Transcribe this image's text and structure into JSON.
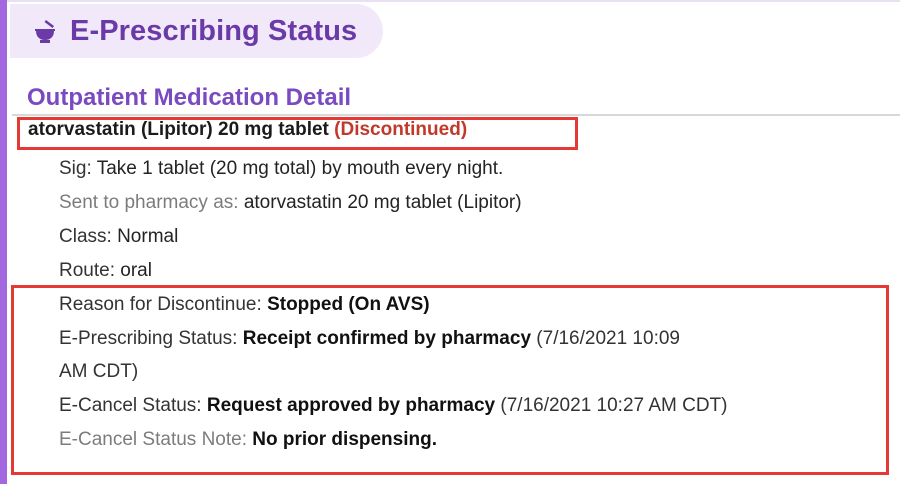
{
  "header": {
    "title": "E-Prescribing Status",
    "icon": "mortar-pestle-icon",
    "accent_color": "#6a3aa6",
    "pill_background": "#f1e8fa"
  },
  "section": {
    "heading": "Outpatient Medication Detail"
  },
  "medication": {
    "name": "atorvastatin (Lipitor) 20 mg tablet",
    "status": "(Discontinued)",
    "status_color": "#c0392b"
  },
  "details": {
    "sig_label": "Sig:",
    "sig_value": "Take 1 tablet (20 mg total) by mouth every night.",
    "sent_label": "Sent to pharmacy as:",
    "sent_value": "atorvastatin 20 mg tablet (Lipitor)",
    "class_label": "Class:",
    "class_value": "Normal",
    "route_label": "Route:",
    "route_value": "oral"
  },
  "status_details": {
    "reason_label": "Reason for Discontinue:",
    "reason_value": "Stopped (On AVS)",
    "erx_label": "E-Prescribing Status:",
    "erx_value": "Receipt confirmed by pharmacy",
    "erx_time_part1": "(7/16/2021 10:09",
    "erx_time_part2": "AM CDT)",
    "cancel_label": "E-Cancel Status:",
    "cancel_value": "Request approved by pharmacy",
    "cancel_time": "(7/16/2021 10:27 AM CDT)",
    "note_label": "E-Cancel Status Note:",
    "note_value": "No prior dispensing."
  },
  "highlight_color": "#e53935"
}
